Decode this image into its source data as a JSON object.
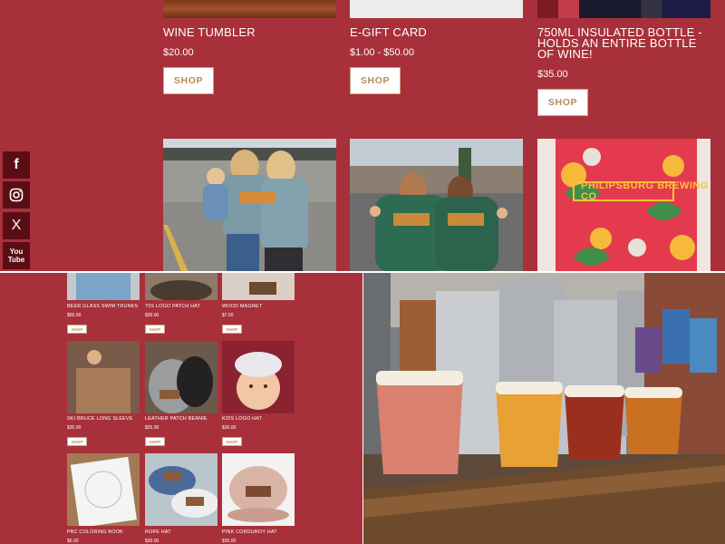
{
  "products_top": [
    {
      "title": "WINE TUMBLER",
      "price": "$20.00",
      "shop": "SHOP"
    },
    {
      "title": "E-GIFT CARD",
      "price": "$1.00 - $50.00",
      "shop": "SHOP"
    },
    {
      "title": "750ML INSULATED BOTTLE - HOLDS AN ENTIRE BOTTLE OF WINE!",
      "price": "$35.00",
      "shop": "SHOP"
    }
  ],
  "social": [
    {
      "icon": "facebook-icon",
      "glyph": "f"
    },
    {
      "icon": "instagram-icon",
      "glyph": "◎"
    },
    {
      "icon": "x-icon",
      "glyph": "X"
    },
    {
      "icon": "youtube-icon",
      "glyph": "You\nTube"
    }
  ],
  "mini_products": [
    {
      "name": "BEER GLASS SWIM TRUNKS",
      "price": "$65.00",
      "shop": "SHOP"
    },
    {
      "name": "70S LOGO PATCH HAT",
      "price": "$30.00",
      "shop": "SHOP"
    },
    {
      "name": "WOOD MAGNET",
      "price": "$7.50",
      "shop": "SHOP"
    },
    {
      "name": "SKI BRUCE LONG SLEEVE",
      "price": "$35.00",
      "shop": "SHOP"
    },
    {
      "name": "LEATHER PATCH BEANIE",
      "price": "$25.00",
      "shop": "SHOP"
    },
    {
      "name": "KIDS LOGO HAT",
      "price": "$30.00",
      "shop": "SHOP"
    },
    {
      "name": "PBC COLORING BOOK",
      "price": "$6.00",
      "shop": ""
    },
    {
      "name": "ROPE HAT",
      "price": "$30.00",
      "shop": ""
    },
    {
      "name": "PINK CORDUROY HAT",
      "price": "$30.00",
      "shop": ""
    }
  ],
  "logo_text": "PHILIPSBURG BREWING CO",
  "colors": {
    "background": "#a8303a",
    "social": "#5a0e14",
    "shop_text": "#b98a5a"
  }
}
